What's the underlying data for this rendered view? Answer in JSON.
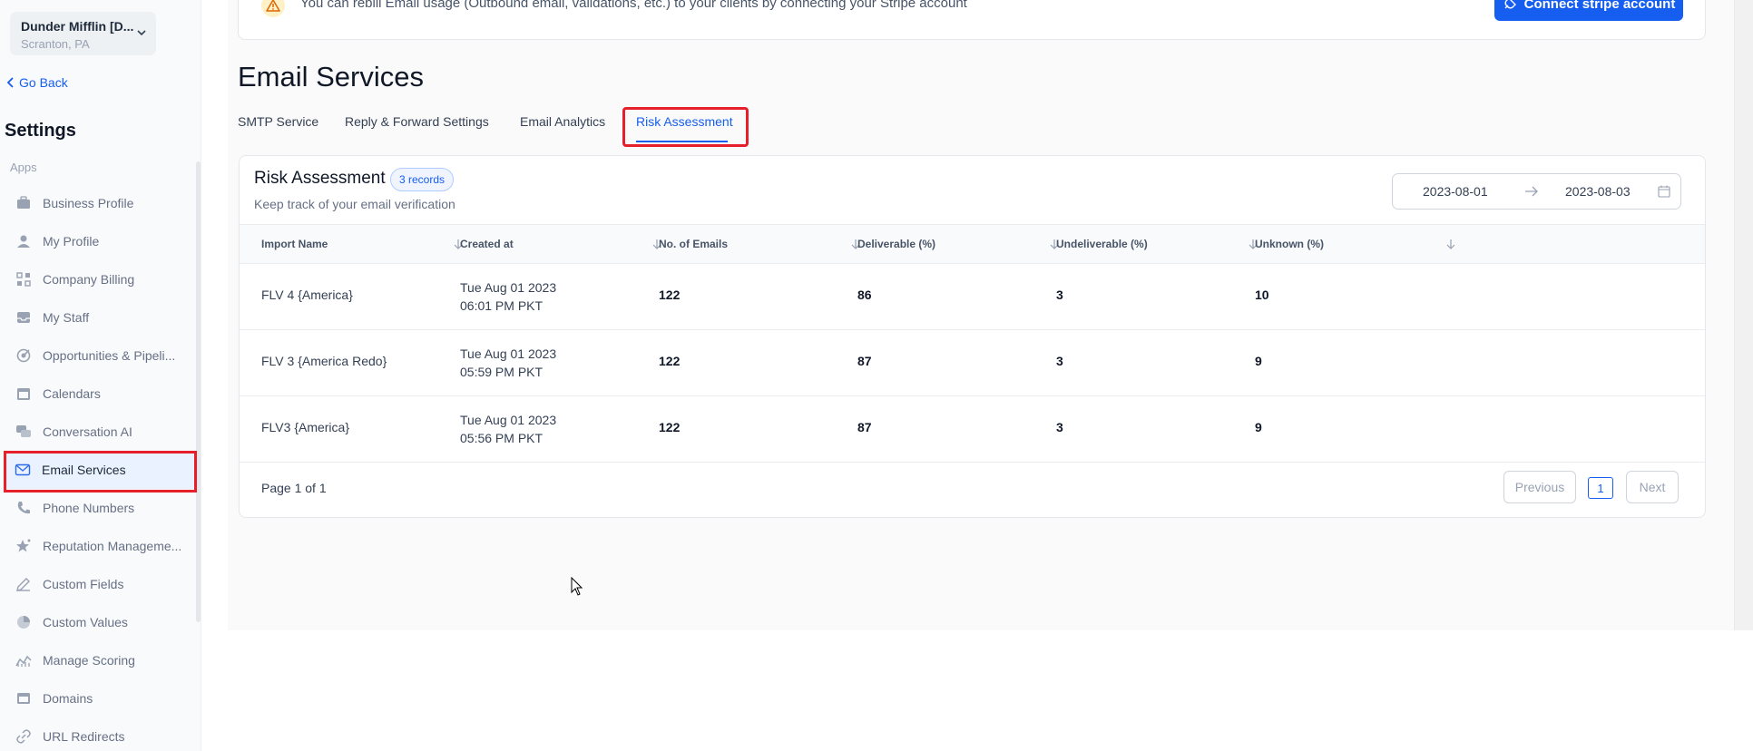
{
  "location": {
    "name": "Dunder Mifflin [D...",
    "city": "Scranton, PA"
  },
  "sidebar": {
    "go_back": "Go Back",
    "title": "Settings",
    "section": "Apps",
    "items": [
      {
        "label": "Business Profile",
        "icon": "briefcase-icon"
      },
      {
        "label": "My Profile",
        "icon": "user-icon"
      },
      {
        "label": "Company Billing",
        "icon": "grid-icon"
      },
      {
        "label": "My Staff",
        "icon": "inbox-icon"
      },
      {
        "label": "Opportunities & Pipeli...",
        "icon": "target-icon"
      },
      {
        "label": "Calendars",
        "icon": "calendar-icon"
      },
      {
        "label": "Conversation AI",
        "icon": "chat-icon"
      },
      {
        "label": "Email Services",
        "icon": "mail-icon"
      },
      {
        "label": "Phone Numbers",
        "icon": "phone-icon"
      },
      {
        "label": "Reputation Manageme...",
        "icon": "star-icon"
      },
      {
        "label": "Custom Fields",
        "icon": "edit-icon"
      },
      {
        "label": "Custom Values",
        "icon": "pie-icon"
      },
      {
        "label": "Manage Scoring",
        "icon": "trend-icon"
      },
      {
        "label": "Domains",
        "icon": "window-icon"
      },
      {
        "label": "URL Redirects",
        "icon": "link-icon"
      }
    ],
    "active_index": 7
  },
  "banner": {
    "text": "You can rebill Email usage (Outbound email, validations, etc.) to your clients by connecting your Stripe account",
    "button": "Connect stripe account"
  },
  "page": {
    "title": "Email Services",
    "tabs": [
      "SMTP Service",
      "Reply & Forward Settings",
      "Email Analytics",
      "Risk Assessment"
    ],
    "active_tab": 3
  },
  "card": {
    "title": "Risk Assessment",
    "badge": "3 records",
    "subtitle": "Keep track of your email verification",
    "date_from": "2023-08-01",
    "date_to": "2023-08-03"
  },
  "table": {
    "columns": [
      "Import Name",
      "Created at",
      "No. of Emails",
      "Deliverable (%)",
      "Undeliverable (%)",
      "Unknown (%)"
    ],
    "rows": [
      {
        "name": "FLV 4 {America}",
        "date": "Tue Aug 01 2023",
        "time": "06:01 PM PKT",
        "emails": "122",
        "deliverable": "86",
        "undeliverable": "3",
        "unknown": "10"
      },
      {
        "name": "FLV 3 {America Redo}",
        "date": "Tue Aug 01 2023",
        "time": "05:59 PM PKT",
        "emails": "122",
        "deliverable": "87",
        "undeliverable": "3",
        "unknown": "9"
      },
      {
        "name": "FLV3 {America}",
        "date": "Tue Aug 01 2023",
        "time": "05:56 PM PKT",
        "emails": "122",
        "deliverable": "87",
        "undeliverable": "3",
        "unknown": "9"
      }
    ]
  },
  "pagination": {
    "text": "Page 1 of 1",
    "previous": "Previous",
    "current": "1",
    "next": "Next"
  }
}
